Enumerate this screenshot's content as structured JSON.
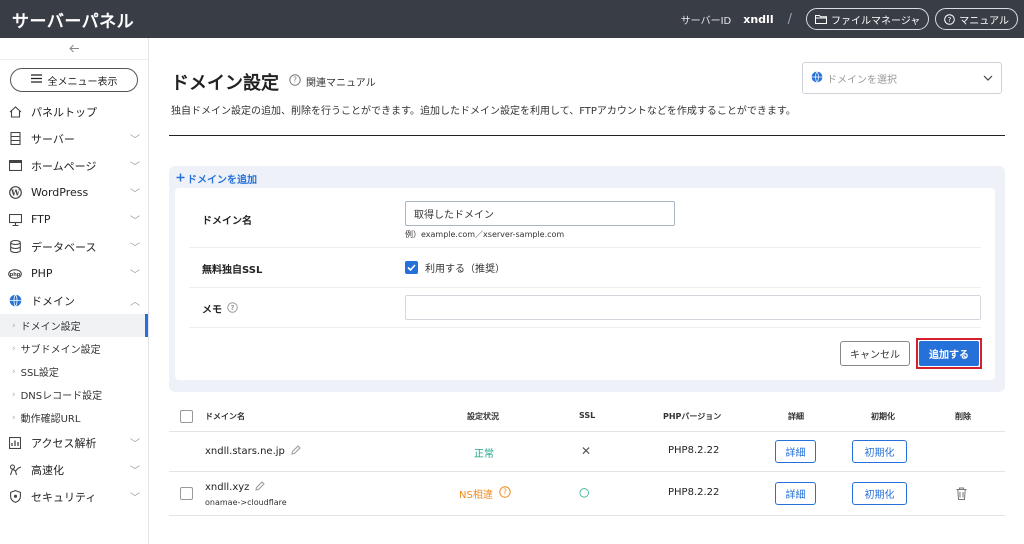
{
  "header": {
    "title": "サーバーパネル",
    "server_id_label": "サーバーID",
    "server_id_value": "xndll",
    "separator": "/",
    "file_manager_label": "ファイルマネージャ",
    "manual_label": "マニュアル"
  },
  "sidebar": {
    "all_menu_label": "全メニュー表示",
    "items": [
      {
        "label": "パネルトップ",
        "icon": "home-icon",
        "has_chevron": false
      },
      {
        "label": "サーバー",
        "icon": "server-icon",
        "has_chevron": true
      },
      {
        "label": "ホームページ",
        "icon": "window-icon",
        "has_chevron": true
      },
      {
        "label": "WordPress",
        "icon": "wordpress-icon",
        "has_chevron": true
      },
      {
        "label": "FTP",
        "icon": "monitor-icon",
        "has_chevron": true
      },
      {
        "label": "データベース",
        "icon": "database-icon",
        "has_chevron": true
      },
      {
        "label": "PHP",
        "icon": "php-icon",
        "has_chevron": true
      },
      {
        "label": "ドメイン",
        "icon": "globe-icon",
        "has_chevron": true,
        "expanded": true
      }
    ],
    "sub_items": [
      {
        "label": "ドメイン設定",
        "active": true
      },
      {
        "label": "サブドメイン設定",
        "active": false
      },
      {
        "label": "SSL設定",
        "active": false
      },
      {
        "label": "DNSレコード設定",
        "active": false
      },
      {
        "label": "動作確認URL",
        "active": false
      }
    ],
    "items_after": [
      {
        "label": "アクセス解析",
        "icon": "chart-icon"
      },
      {
        "label": "高速化",
        "icon": "speed-icon"
      },
      {
        "label": "セキュリティ",
        "icon": "shield-icon"
      }
    ]
  },
  "main": {
    "title": "ドメイン設定",
    "manual_link": "関連マニュアル",
    "domain_select_placeholder": "ドメインを選択",
    "description": "独自ドメイン設定の追加、削除を行うことができます。追加したドメイン設定を利用して、FTPアカウントなどを作成することができます。"
  },
  "add_form": {
    "section_title": "ドメインを追加",
    "domain_label": "ドメイン名",
    "domain_value": "取得したドメイン",
    "domain_hint": "例）example.com／xserver-sample.com",
    "ssl_label": "無料独自SSL",
    "ssl_checkbox_label": "利用する（推奨）",
    "ssl_checked": true,
    "memo_label": "メモ",
    "memo_value": "",
    "cancel_label": "キャンセル",
    "add_label": "追加する"
  },
  "table": {
    "headers": {
      "domain": "ドメイン名",
      "status": "設定状況",
      "ssl": "SSL",
      "php": "PHPバージョン",
      "detail": "詳細",
      "init": "初期化",
      "delete": "削除"
    },
    "rows": [
      {
        "domain": "xndll.stars.ne.jp",
        "sub": "",
        "status": "正常",
        "status_color": "#1fa38a",
        "ssl": "✕",
        "php": "PHP8.2.22",
        "detail": "詳細",
        "init": "初期化",
        "has_checkbox": false,
        "has_delete": false
      },
      {
        "domain": "xndll.xyz",
        "sub": "onamae->cloudflare",
        "status": "NS相違",
        "status_color": "#f08a1c",
        "ssl": "○",
        "php": "PHP8.2.22",
        "detail": "詳細",
        "init": "初期化",
        "has_checkbox": true,
        "has_delete": true
      }
    ]
  },
  "colors": {
    "accent": "#2671d9",
    "header_bg": "#393d45",
    "highlight_border": "#d41f2c",
    "ok_green": "#1fa38a",
    "warn_orange": "#f08a1c"
  }
}
